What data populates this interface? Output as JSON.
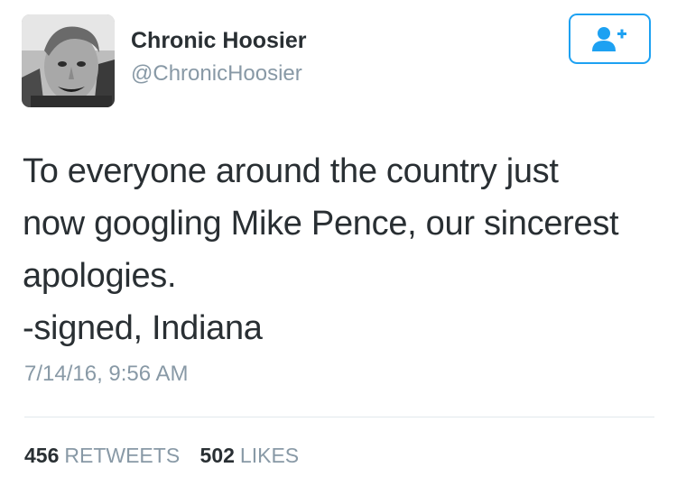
{
  "user": {
    "display_name": "Chronic Hoosier",
    "handle": "@ChronicHoosier",
    "avatar_icon": "user-photo"
  },
  "follow_button": {
    "icon": "add-user-icon",
    "color": "#1da1f2"
  },
  "tweet": {
    "lines": [
      "To everyone around the country just",
      "now googling Mike Pence, our sincerest",
      "apologies.",
      "-signed, Indiana"
    ],
    "timestamp": "7/14/16, 9:56 AM"
  },
  "stats": {
    "retweets_count": "456",
    "retweets_label": "RETWEETS",
    "likes_count": "502",
    "likes_label": "LIKES"
  },
  "colors": {
    "text": "#292f33",
    "muted": "#8899a6",
    "accent": "#1da1f2",
    "divider": "#e1e8ed"
  }
}
